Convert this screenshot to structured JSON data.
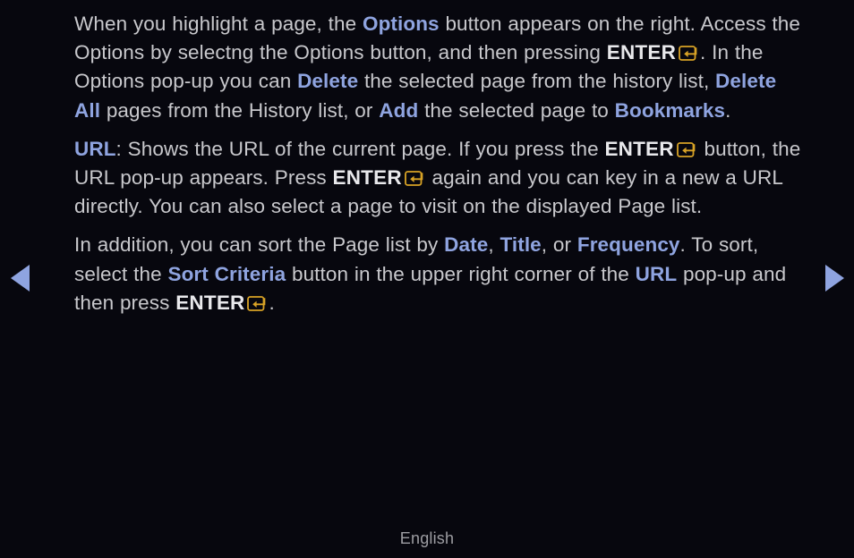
{
  "screen": {
    "background_color": "#07070e",
    "body_text_color": "#c8c8cc",
    "keyword_color": "#8fa4e0",
    "enter_key_color": "#d9a326",
    "footer_text_color": "#9d9da2"
  },
  "paragraphs": [
    {
      "id": "para-options",
      "segments": [
        {
          "type": "text",
          "value": "When you highlight a page, the "
        },
        {
          "type": "kw",
          "value": "Options"
        },
        {
          "type": "text",
          "value": " button appears on the right. Access the Options by selectng the Options button, and then pressing "
        },
        {
          "type": "bold",
          "value": "ENTER"
        },
        {
          "type": "icon",
          "value": "enter-key-icon"
        },
        {
          "type": "text",
          "value": ". In the Options pop-up you can "
        },
        {
          "type": "kw",
          "value": "Delete"
        },
        {
          "type": "text",
          "value": " the selected page from the history list, "
        },
        {
          "type": "kw",
          "value": "Delete All"
        },
        {
          "type": "text",
          "value": " pages from the History list, or "
        },
        {
          "type": "kw",
          "value": "Add"
        },
        {
          "type": "text",
          "value": " the selected page to "
        },
        {
          "type": "kw",
          "value": "Bookmarks"
        },
        {
          "type": "text",
          "value": "."
        }
      ]
    },
    {
      "id": "para-url",
      "segments": [
        {
          "type": "kw",
          "value": "URL"
        },
        {
          "type": "text",
          "value": ": Shows the URL of the current page. If you press the "
        },
        {
          "type": "bold",
          "value": "ENTER"
        },
        {
          "type": "icon",
          "value": "enter-key-icon"
        },
        {
          "type": "text",
          "value": " button, the URL pop-up appears. Press "
        },
        {
          "type": "bold",
          "value": "ENTER"
        },
        {
          "type": "icon",
          "value": "enter-key-icon"
        },
        {
          "type": "text",
          "value": " again and you can key in a new a URL directly. You can also select a page to visit on the displayed Page list."
        }
      ]
    },
    {
      "id": "para-sort",
      "segments": [
        {
          "type": "text",
          "value": "In addition, you can sort the Page list by "
        },
        {
          "type": "kw",
          "value": "Date"
        },
        {
          "type": "text",
          "value": ", "
        },
        {
          "type": "kw",
          "value": "Title"
        },
        {
          "type": "text",
          "value": ", or "
        },
        {
          "type": "kw",
          "value": "Frequency"
        },
        {
          "type": "text",
          "value": ". To sort, select the "
        },
        {
          "type": "kw",
          "value": "Sort Criteria"
        },
        {
          "type": "text",
          "value": " button in the upper right corner of the "
        },
        {
          "type": "kw",
          "value": "URL"
        },
        {
          "type": "text",
          "value": " pop-up and then press "
        },
        {
          "type": "bold",
          "value": "ENTER"
        },
        {
          "type": "icon",
          "value": "enter-key-icon"
        },
        {
          "type": "text",
          "value": "."
        }
      ]
    }
  ],
  "navigation": {
    "previous_icon": "triangle-left-icon",
    "next_icon": "triangle-right-icon"
  },
  "footer": {
    "language": "English"
  }
}
